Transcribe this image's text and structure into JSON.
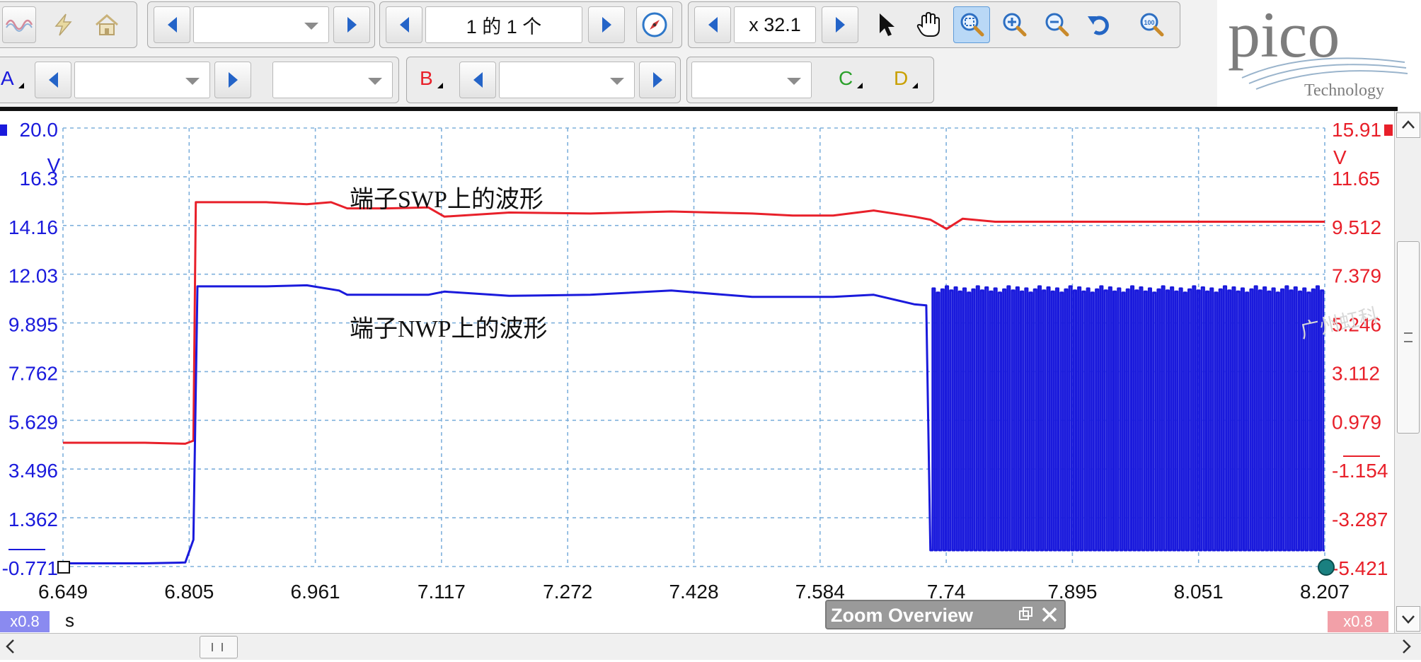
{
  "app": {
    "brand": "pico",
    "brand_sub": "Technology"
  },
  "toolbar": {
    "buffer_nav": {
      "value": "1 的 1 个"
    },
    "zoom": {
      "value": "x 32.1"
    },
    "tools": [
      "select-pointer",
      "hand-pan",
      "zoom-area",
      "zoom-in",
      "zoom-out",
      "undo-zoom",
      "zoom-to-fit"
    ]
  },
  "channels": {
    "a": "A",
    "b": "B",
    "c": "C",
    "d": "D"
  },
  "plot": {
    "left_axis": {
      "unit": "V",
      "ticks": [
        "20.0",
        "16.3",
        "14.16",
        "12.03",
        "9.895",
        "7.762",
        "5.629",
        "3.496",
        "1.362",
        "-0.771"
      ],
      "color": "#1a1adc"
    },
    "right_axis": {
      "unit": "V",
      "ticks": [
        "15.91",
        "11.65",
        "9.512",
        "7.379",
        "5.246",
        "3.112",
        "0.979",
        "-1.154",
        "-3.287",
        "-5.421"
      ],
      "color": "#e8202a"
    },
    "time_axis": {
      "unit": "s",
      "ticks": [
        "6.649",
        "6.805",
        "6.961",
        "7.117",
        "7.272",
        "7.428",
        "7.584",
        "7.74",
        "7.895",
        "8.051",
        "8.207"
      ]
    },
    "annotations": {
      "swp": "端子SWP上的波形",
      "nwp": "端子NWP上的波形"
    },
    "left_scale_badge": "x0.8",
    "right_scale_badge": "x0.8",
    "zoom_overview_label": "Zoom Overview",
    "watermark": "广州虹科"
  },
  "chart_data": {
    "type": "line",
    "title": "",
    "xlabel": "s",
    "ylabel": "V",
    "xlim": [
      6.649,
      8.207
    ],
    "ylim_left": [
      -0.771,
      20.0
    ],
    "ylim_right": [
      -5.421,
      15.91
    ],
    "series": [
      {
        "name": "端子SWP上的波形",
        "axis": "right",
        "color": "#e8202a",
        "x": [
          6.649,
          6.7,
          6.75,
          6.8,
          6.81,
          6.813,
          6.85,
          6.9,
          6.95,
          6.98,
          7.0,
          7.05,
          7.1,
          7.12,
          7.2,
          7.3,
          7.4,
          7.5,
          7.55,
          7.6,
          7.65,
          7.7,
          7.72,
          7.74,
          7.76,
          7.8,
          7.9,
          8.0,
          8.1,
          8.207
        ],
        "values": [
          0.6,
          0.6,
          0.6,
          0.55,
          0.7,
          12.3,
          12.3,
          12.3,
          12.2,
          12.3,
          12.0,
          12.0,
          12.05,
          11.6,
          11.8,
          11.75,
          11.85,
          11.75,
          11.65,
          11.65,
          11.9,
          11.6,
          11.45,
          11.0,
          11.5,
          11.35,
          11.35,
          11.35,
          11.35,
          11.35
        ]
      },
      {
        "name": "端子NWP上的波形",
        "axis": "left",
        "color": "#1a1adc",
        "x": [
          6.649,
          6.7,
          6.75,
          6.8,
          6.81,
          6.815,
          6.85,
          6.9,
          6.95,
          6.99,
          7.0,
          7.1,
          7.12,
          7.2,
          7.3,
          7.4,
          7.5,
          7.6,
          7.65,
          7.7,
          7.715,
          7.72,
          8.207
        ],
        "values": [
          -0.62,
          -0.62,
          -0.62,
          -0.58,
          0.5,
          12.5,
          12.5,
          12.5,
          12.55,
          12.3,
          12.1,
          12.1,
          12.25,
          12.05,
          12.1,
          12.3,
          12.0,
          12.0,
          12.1,
          11.65,
          11.6,
          0.0,
          12.5
        ],
        "pulse_train": {
          "start": 7.72,
          "end": 8.207,
          "low": 0.0,
          "high": 12.5,
          "period": 0.00545
        }
      }
    ],
    "grid": true
  }
}
